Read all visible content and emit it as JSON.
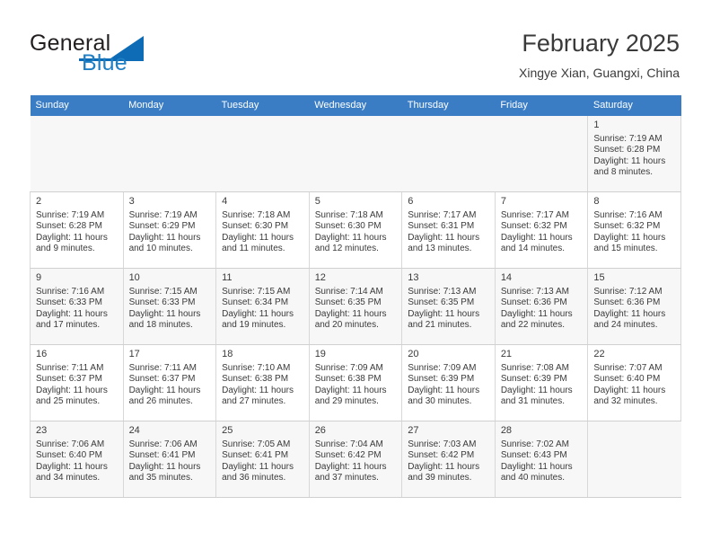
{
  "brand": {
    "name_top": "General",
    "name_bottom": "Blue",
    "accent_color": "#0d6cb5",
    "logo_icon": "triangle-flag-icon"
  },
  "header": {
    "title": "February 2025",
    "subtitle": "Xingye Xian, Guangxi, China"
  },
  "calendar": {
    "header_bg": "#3a7dc5",
    "header_text_color": "#ffffff",
    "weekdays": [
      "Sunday",
      "Monday",
      "Tuesday",
      "Wednesday",
      "Thursday",
      "Friday",
      "Saturday"
    ],
    "weeks": [
      [
        null,
        null,
        null,
        null,
        null,
        null,
        {
          "day": "1",
          "sunrise": "Sunrise: 7:19 AM",
          "sunset": "Sunset: 6:28 PM",
          "daylight_1": "Daylight: 11 hours",
          "daylight_2": "and 8 minutes."
        }
      ],
      [
        {
          "day": "2",
          "sunrise": "Sunrise: 7:19 AM",
          "sunset": "Sunset: 6:28 PM",
          "daylight_1": "Daylight: 11 hours",
          "daylight_2": "and 9 minutes."
        },
        {
          "day": "3",
          "sunrise": "Sunrise: 7:19 AM",
          "sunset": "Sunset: 6:29 PM",
          "daylight_1": "Daylight: 11 hours",
          "daylight_2": "and 10 minutes."
        },
        {
          "day": "4",
          "sunrise": "Sunrise: 7:18 AM",
          "sunset": "Sunset: 6:30 PM",
          "daylight_1": "Daylight: 11 hours",
          "daylight_2": "and 11 minutes."
        },
        {
          "day": "5",
          "sunrise": "Sunrise: 7:18 AM",
          "sunset": "Sunset: 6:30 PM",
          "daylight_1": "Daylight: 11 hours",
          "daylight_2": "and 12 minutes."
        },
        {
          "day": "6",
          "sunrise": "Sunrise: 7:17 AM",
          "sunset": "Sunset: 6:31 PM",
          "daylight_1": "Daylight: 11 hours",
          "daylight_2": "and 13 minutes."
        },
        {
          "day": "7",
          "sunrise": "Sunrise: 7:17 AM",
          "sunset": "Sunset: 6:32 PM",
          "daylight_1": "Daylight: 11 hours",
          "daylight_2": "and 14 minutes."
        },
        {
          "day": "8",
          "sunrise": "Sunrise: 7:16 AM",
          "sunset": "Sunset: 6:32 PM",
          "daylight_1": "Daylight: 11 hours",
          "daylight_2": "and 15 minutes."
        }
      ],
      [
        {
          "day": "9",
          "sunrise": "Sunrise: 7:16 AM",
          "sunset": "Sunset: 6:33 PM",
          "daylight_1": "Daylight: 11 hours",
          "daylight_2": "and 17 minutes."
        },
        {
          "day": "10",
          "sunrise": "Sunrise: 7:15 AM",
          "sunset": "Sunset: 6:33 PM",
          "daylight_1": "Daylight: 11 hours",
          "daylight_2": "and 18 minutes."
        },
        {
          "day": "11",
          "sunrise": "Sunrise: 7:15 AM",
          "sunset": "Sunset: 6:34 PM",
          "daylight_1": "Daylight: 11 hours",
          "daylight_2": "and 19 minutes."
        },
        {
          "day": "12",
          "sunrise": "Sunrise: 7:14 AM",
          "sunset": "Sunset: 6:35 PM",
          "daylight_1": "Daylight: 11 hours",
          "daylight_2": "and 20 minutes."
        },
        {
          "day": "13",
          "sunrise": "Sunrise: 7:13 AM",
          "sunset": "Sunset: 6:35 PM",
          "daylight_1": "Daylight: 11 hours",
          "daylight_2": "and 21 minutes."
        },
        {
          "day": "14",
          "sunrise": "Sunrise: 7:13 AM",
          "sunset": "Sunset: 6:36 PM",
          "daylight_1": "Daylight: 11 hours",
          "daylight_2": "and 22 minutes."
        },
        {
          "day": "15",
          "sunrise": "Sunrise: 7:12 AM",
          "sunset": "Sunset: 6:36 PM",
          "daylight_1": "Daylight: 11 hours",
          "daylight_2": "and 24 minutes."
        }
      ],
      [
        {
          "day": "16",
          "sunrise": "Sunrise: 7:11 AM",
          "sunset": "Sunset: 6:37 PM",
          "daylight_1": "Daylight: 11 hours",
          "daylight_2": "and 25 minutes."
        },
        {
          "day": "17",
          "sunrise": "Sunrise: 7:11 AM",
          "sunset": "Sunset: 6:37 PM",
          "daylight_1": "Daylight: 11 hours",
          "daylight_2": "and 26 minutes."
        },
        {
          "day": "18",
          "sunrise": "Sunrise: 7:10 AM",
          "sunset": "Sunset: 6:38 PM",
          "daylight_1": "Daylight: 11 hours",
          "daylight_2": "and 27 minutes."
        },
        {
          "day": "19",
          "sunrise": "Sunrise: 7:09 AM",
          "sunset": "Sunset: 6:38 PM",
          "daylight_1": "Daylight: 11 hours",
          "daylight_2": "and 29 minutes."
        },
        {
          "day": "20",
          "sunrise": "Sunrise: 7:09 AM",
          "sunset": "Sunset: 6:39 PM",
          "daylight_1": "Daylight: 11 hours",
          "daylight_2": "and 30 minutes."
        },
        {
          "day": "21",
          "sunrise": "Sunrise: 7:08 AM",
          "sunset": "Sunset: 6:39 PM",
          "daylight_1": "Daylight: 11 hours",
          "daylight_2": "and 31 minutes."
        },
        {
          "day": "22",
          "sunrise": "Sunrise: 7:07 AM",
          "sunset": "Sunset: 6:40 PM",
          "daylight_1": "Daylight: 11 hours",
          "daylight_2": "and 32 minutes."
        }
      ],
      [
        {
          "day": "23",
          "sunrise": "Sunrise: 7:06 AM",
          "sunset": "Sunset: 6:40 PM",
          "daylight_1": "Daylight: 11 hours",
          "daylight_2": "and 34 minutes."
        },
        {
          "day": "24",
          "sunrise": "Sunrise: 7:06 AM",
          "sunset": "Sunset: 6:41 PM",
          "daylight_1": "Daylight: 11 hours",
          "daylight_2": "and 35 minutes."
        },
        {
          "day": "25",
          "sunrise": "Sunrise: 7:05 AM",
          "sunset": "Sunset: 6:41 PM",
          "daylight_1": "Daylight: 11 hours",
          "daylight_2": "and 36 minutes."
        },
        {
          "day": "26",
          "sunrise": "Sunrise: 7:04 AM",
          "sunset": "Sunset: 6:42 PM",
          "daylight_1": "Daylight: 11 hours",
          "daylight_2": "and 37 minutes."
        },
        {
          "day": "27",
          "sunrise": "Sunrise: 7:03 AM",
          "sunset": "Sunset: 6:42 PM",
          "daylight_1": "Daylight: 11 hours",
          "daylight_2": "and 39 minutes."
        },
        {
          "day": "28",
          "sunrise": "Sunrise: 7:02 AM",
          "sunset": "Sunset: 6:43 PM",
          "daylight_1": "Daylight: 11 hours",
          "daylight_2": "and 40 minutes."
        },
        null
      ]
    ]
  }
}
